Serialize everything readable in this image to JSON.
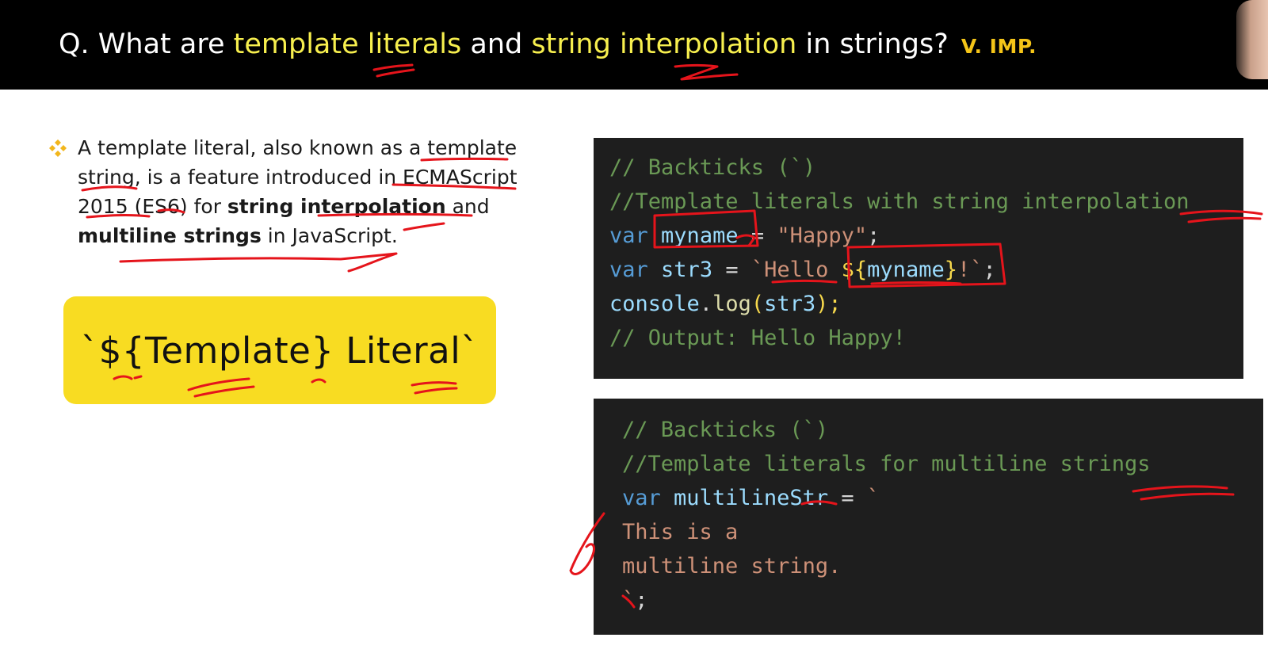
{
  "header": {
    "q_prefix": "Q. What are ",
    "term1": "template literals",
    "and": " and ",
    "term2": "string interpolation",
    "suffix": " in strings?",
    "importance": "V. IMP."
  },
  "bullet": {
    "icon": "diamond-bullet-icon",
    "part1": "A template literal, also known as a template string, is a feature introduced in ECMAScript 2015 (ES6) for ",
    "bold1": "string interpolation",
    "part2": " and ",
    "bold2": "multiline strings",
    "part3": " in JavaScript."
  },
  "card": {
    "label": "`${Template} Literal`"
  },
  "code1": {
    "line1": "// Backticks (`)",
    "line2": "//Template literals with string interpolation",
    "line3_kw": "var",
    "line3_var": "myname",
    "line3_op": " = ",
    "line3_str": "\"Happy\"",
    "line3_end": ";",
    "line4_kw": "var",
    "line4_var": "str3",
    "line4_op": " = ",
    "line4_str": "`Hello ",
    "line4_tpl_open": "${",
    "line4_tpl_var": "myname",
    "line4_tpl_close": "}",
    "line4_str_end": "!`",
    "line4_end": ";",
    "line5_obj": "console",
    "line5_dot": ".",
    "line5_fn": "log",
    "line5_open": "(",
    "line5_arg": "str3",
    "line5_close": ");",
    "line6": "// Output: Hello Happy!"
  },
  "code2": {
    "line1": "// Backticks (`)",
    "line2": "//Template literals for multiline strings",
    "line3_kw": "var",
    "line3_var": "multilineStr",
    "line3_op": " = ",
    "line3_str": "`",
    "line4": "This is a",
    "line5": "multiline string.",
    "line6_str": "`",
    "line6_end": ";"
  },
  "colors": {
    "header_bg": "#000000",
    "highlight": "#f7ef4e",
    "importance": "#f5c518",
    "card_bg": "#f8dc22",
    "code_bg": "#1e1e1e",
    "annotation_red": "#e5141b"
  }
}
